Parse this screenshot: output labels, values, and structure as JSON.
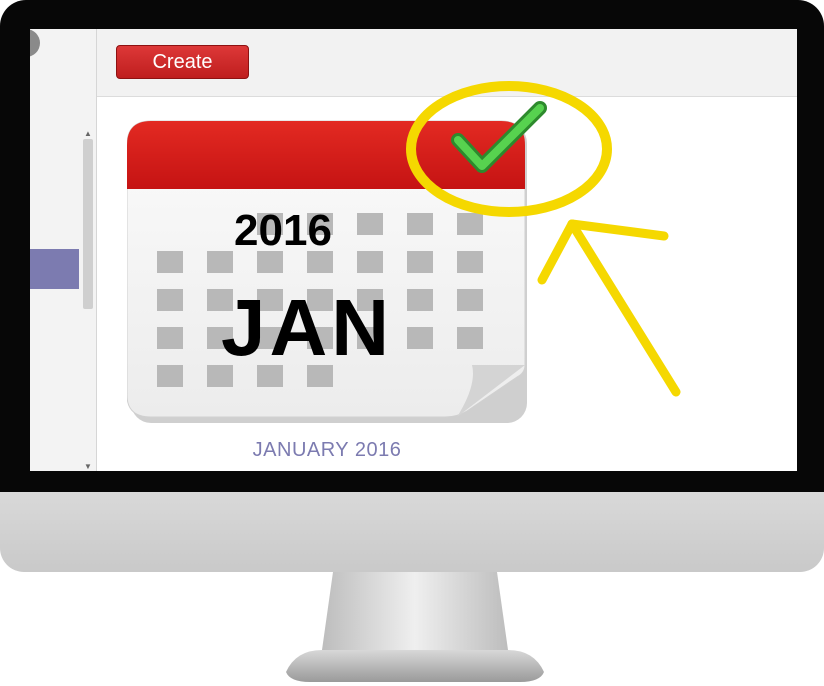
{
  "toolbar": {
    "create_label": "Create"
  },
  "calendar": {
    "year": "2016",
    "month": "JAN",
    "caption": "JANUARY 2016"
  },
  "colors": {
    "calendar_header": "#d91b1b",
    "caption_text": "#7c7bb0",
    "highlight": "#f5d800",
    "checkmark": "#3fb83f",
    "button": "#cc2222"
  },
  "icons": {
    "checkmark": "checkmark-icon",
    "arrow": "highlight-arrow",
    "circle": "highlight-circle"
  }
}
